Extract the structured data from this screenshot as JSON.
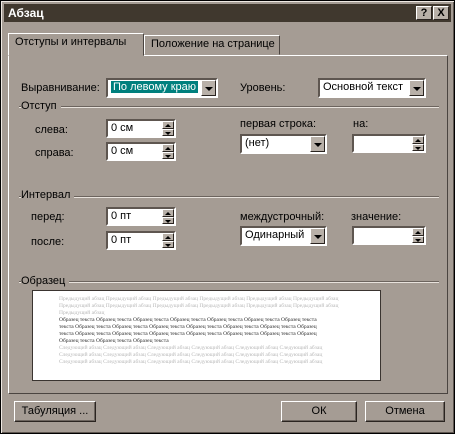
{
  "window": {
    "title": "Абзац",
    "help_glyph": "?",
    "close_glyph": "X"
  },
  "tabs": [
    {
      "label": "Отступы и интервалы",
      "active": true
    },
    {
      "label": "Положение на странице",
      "active": false
    }
  ],
  "alignment": {
    "label": "Выравнивание:",
    "value": "По левому краю"
  },
  "level": {
    "label": "Уровень:",
    "value": "Основной текст"
  },
  "indent": {
    "title": "Отступ",
    "left_label": "слева:",
    "left_value": "0 см",
    "right_label": "справа:",
    "right_value": "0 см",
    "first_line_label": "первая строка:",
    "first_line_value": "(нет)",
    "on_label": "на:",
    "on_value": ""
  },
  "spacing": {
    "title": "Интервал",
    "before_label": "перед:",
    "before_value": "0 пт",
    "after_label": "после:",
    "after_value": "0 пт",
    "line_label": "междустрочный:",
    "line_value": "Одинарный",
    "value_label": "значение:",
    "value_value": ""
  },
  "preview": {
    "title": "Образец",
    "prev_lines": [
      "Предыдущий абзац Предыдущий абзац Предыдущий абзац Предыдущий абзац Предыдущий абзац Предыдущий абзац",
      "Предыдущий абзац Предыдущий абзац Предыдущий абзац Предыдущий абзац Предыдущий абзац Предыдущий абзац",
      "Предыдущий абзац"
    ],
    "sample_lines": [
      "Образец текста Образец текста Образец текста Образец текста Образец текста Образец текста Образец текста",
      "текста Образец текста Образец текста Образец текста Образец текста Образец текста Образец текста Образец",
      "текста Образец текста Образец текста Образец текста Образец текста Образец текста Образец текста Образец",
      "Образец текста Образец текста Образец текста"
    ],
    "next_lines": [
      "Следующий абзац Следующий абзац Следующий абзац Следующий абзац Следующий абзац Следующий абзац",
      "Следующий абзац Следующий абзац Следующий абзац Следующий абзац Следующий абзац Следующий абзац",
      "Следующий абзац Следующий абзац Следующий абзац Следующий абзац Следующий абзац Следующий абзац"
    ]
  },
  "buttons": {
    "tabs_label": "Табуляция ...",
    "ok_label": "ОК",
    "cancel_label": "Отмена"
  },
  "colors": {
    "dialog_bg": "#a59c94",
    "titlebar_bg": "#40382e",
    "selection": "#00807e"
  }
}
